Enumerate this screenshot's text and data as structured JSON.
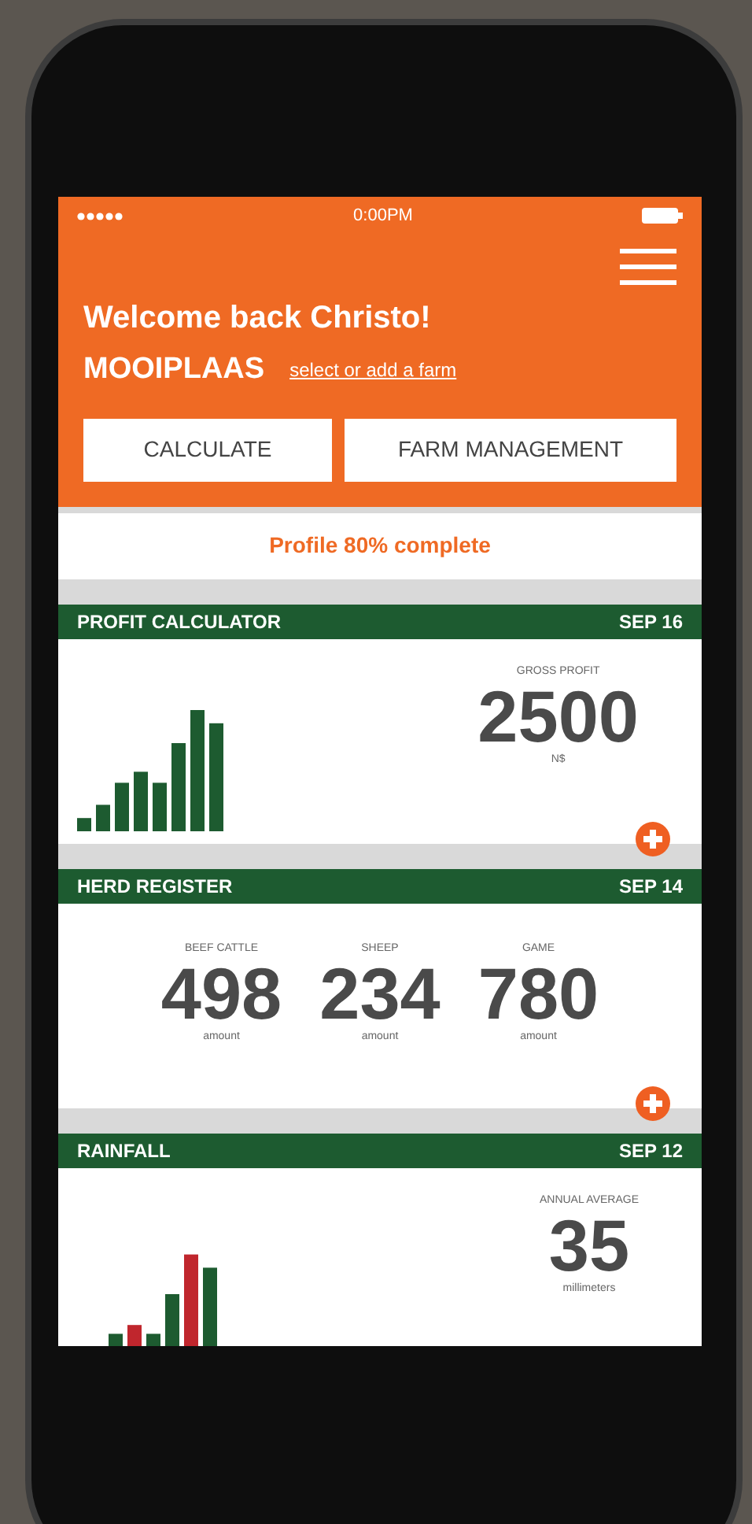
{
  "status_bar": {
    "time": "0:00PM"
  },
  "header": {
    "greeting": "Welcome back Christo!",
    "farm_name": "MOOIPLAAS",
    "farm_link": "select or add a farm",
    "buttons": [
      "CALCULATE",
      "FARM MANAGEMENT"
    ]
  },
  "profile_banner": "Profile 80% complete",
  "cards": [
    {
      "kind": "chart",
      "title": "PROFIT CALCULATOR",
      "date": "SEP 16",
      "stats": [
        {
          "label": "GROSS PROFIT",
          "value": "2500",
          "unit": "N$"
        }
      ],
      "add_button": true
    },
    {
      "kind": "counts",
      "title": "HERD REGISTER",
      "date": "SEP 14",
      "stats": [
        {
          "label": "BEEF CATTLE",
          "value": "498",
          "unit": "amount"
        },
        {
          "label": "SHEEP",
          "value": "234",
          "unit": "amount"
        },
        {
          "label": "GAME",
          "value": "780",
          "unit": "amount"
        }
      ],
      "add_button": true
    },
    {
      "kind": "chart",
      "title": "RAINFALL",
      "date": "SEP 12",
      "stats": [
        {
          "label": "ANNUAL AVERAGE",
          "value": "35",
          "unit": "millimeters"
        }
      ],
      "add_button": false
    }
  ]
}
